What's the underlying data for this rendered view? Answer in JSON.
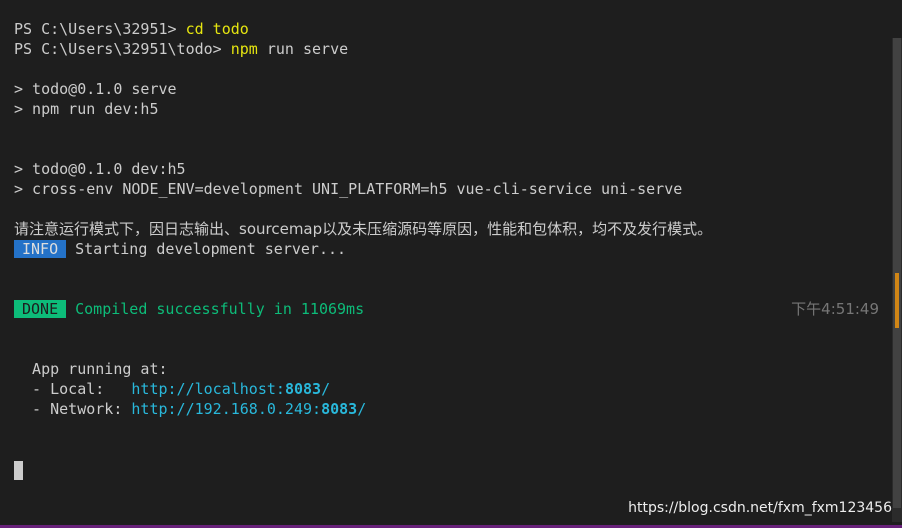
{
  "terminal": {
    "lines": {
      "l1": {
        "prompt": "PS C:\\Users\\32951> ",
        "command": "cd todo"
      },
      "l2": {
        "prompt": "PS C:\\Users\\32951\\todo> ",
        "command": "npm",
        "args": " run serve"
      },
      "l3": "> todo@0.1.0 serve",
      "l4": "> npm run dev:h5",
      "l5": "> todo@0.1.0 dev:h5",
      "l6": "> cross-env NODE_ENV=development UNI_PLATFORM=h5 vue-cli-service uni-serve",
      "l7": "请注意运行模式下，因日志输出、sourcemap以及未压缩源码等原因，性能和包体积，均不及发行模式。",
      "l8": {
        "badge": "INFO",
        "text": "Starting development server..."
      },
      "l9": {
        "badge": "DONE",
        "text": "Compiled successfully in 11069ms",
        "time": "下午4:51:49"
      },
      "l10": "  App running at:",
      "l11": {
        "label": "  - Local:   ",
        "url_prefix": "http://localhost:",
        "port": "8083",
        "url_suffix": "/"
      },
      "l12": {
        "label": "  - Network: ",
        "url_prefix": "http://192.168.0.249:",
        "port": "8083",
        "url_suffix": "/"
      }
    }
  },
  "watermark": "https://blog.csdn.net/fxm_fxm123456",
  "colors": {
    "background": "#1e1e1e",
    "text": "#cccccc",
    "command": "#e5e510",
    "info_badge": "#2472c8",
    "done_badge": "#0dbc79",
    "url": "#29b8db",
    "scroll_marker": "#d18616"
  }
}
